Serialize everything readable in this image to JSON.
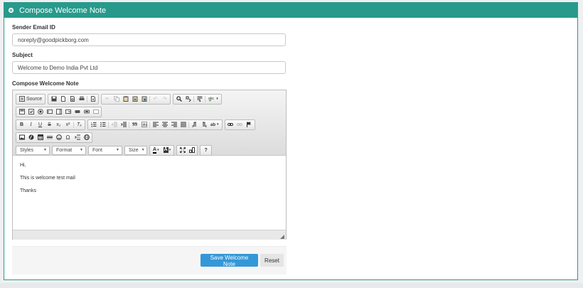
{
  "header": {
    "title": "Compose Welcome Note",
    "icon": "gear-icon"
  },
  "sender": {
    "label": "Sender Email ID",
    "value": "noreply@goodpickborg.com"
  },
  "subject": {
    "label": "Subject",
    "value": "Welcome to Demo India Pvt Ltd"
  },
  "compose": {
    "label": "Compose Welcome Note"
  },
  "toolbar": {
    "source_label": "Source",
    "styles_label": "Styles",
    "format_label": "Format",
    "font_label": "Font",
    "size_label": "Size",
    "bold": "B",
    "italic": "I",
    "underline": "U",
    "strike": "S",
    "subscript": "x₂",
    "superscript": "x²",
    "clear_format": "Tₓ",
    "quote": "99",
    "omega": "Ω",
    "help": "?",
    "text_color": "A",
    "bg_color": "A"
  },
  "body": {
    "lines": [
      "Hi,",
      "This is welcome test mail",
      "Thanks"
    ]
  },
  "actions": {
    "save_label": "Save Welcome Note",
    "reset_label": "Reset"
  },
  "colors": {
    "header": "#279a8c",
    "primary": "#3497d8"
  }
}
